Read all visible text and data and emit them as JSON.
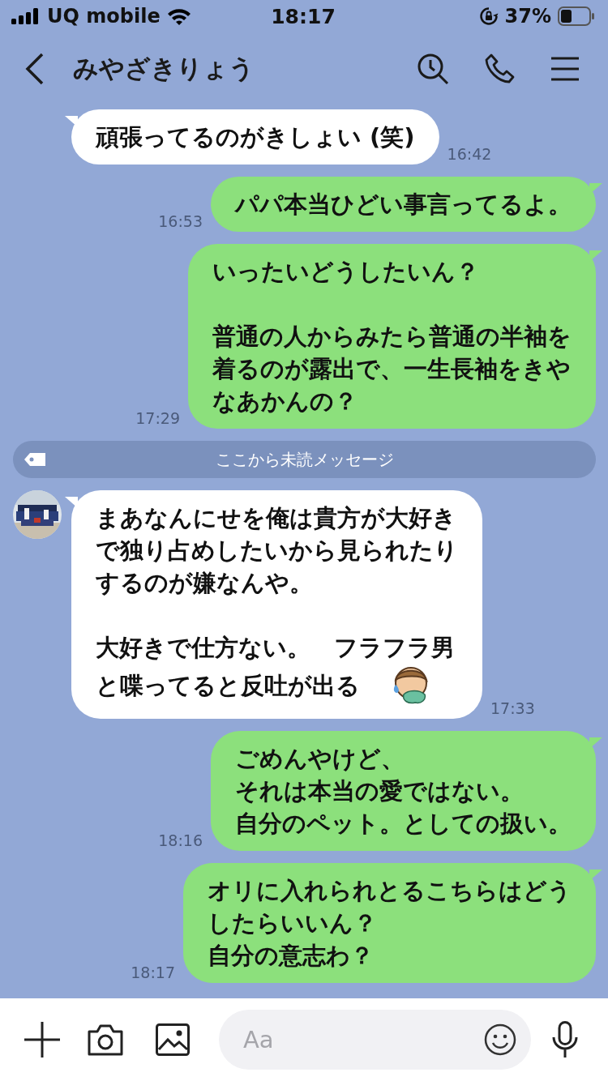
{
  "status_bar": {
    "carrier": "UQ mobile",
    "time": "18:17",
    "battery": "37%"
  },
  "header": {
    "title": "みやざきりょう"
  },
  "messages": [
    {
      "kind": "received",
      "avatar": false,
      "sticker": false,
      "paragraphs": [
        [
          "頑張ってるのがきしょい (笑)"
        ]
      ],
      "time": "16:42"
    },
    {
      "kind": "sent",
      "paragraphs": [
        [
          "パパ本当ひどい事言ってるよ。"
        ]
      ],
      "time": "16:53"
    },
    {
      "kind": "sent",
      "paragraphs": [
        [
          "いったいどうしたいん？"
        ],
        [
          "普通の人からみたら普通の半袖を",
          "着るのが露出で、一生長袖をきや",
          "なあかんの？"
        ]
      ],
      "time": "17:29"
    },
    {
      "kind": "divider",
      "text": "ここから未読メッセージ"
    },
    {
      "kind": "received",
      "avatar": true,
      "sticker": true,
      "paragraphs": [
        [
          "まあなんにせを俺は貴方が大好き",
          "で独り占めしたいから見られたり",
          "するのが嫌なんや。"
        ],
        [
          "大好きで仕方ない。　フラフラ男",
          "と喋ってると反吐が出る"
        ]
      ],
      "time": "17:33"
    },
    {
      "kind": "sent",
      "paragraphs": [
        [
          "ごめんやけど、",
          "それは本当の愛ではない。",
          "自分のペット。としての扱い。"
        ]
      ],
      "time": "18:16"
    },
    {
      "kind": "sent",
      "paragraphs": [
        [
          "オリに入れられとるこちらはどう",
          "したらいいん？",
          "自分の意志わ？"
        ]
      ],
      "time": "18:17"
    }
  ],
  "input": {
    "placeholder": "Aa"
  }
}
